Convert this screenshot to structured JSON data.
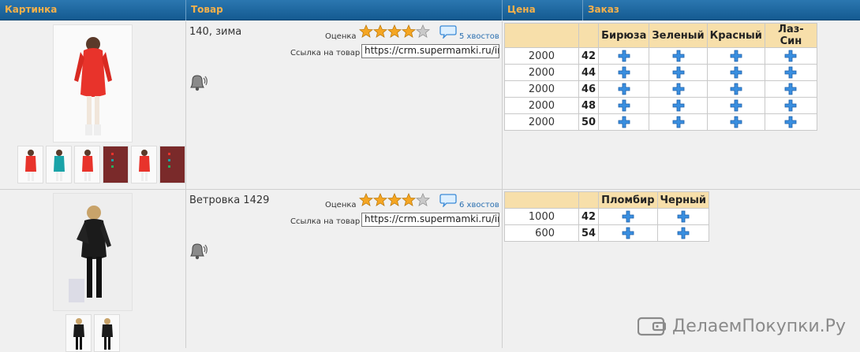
{
  "header": {
    "cols": [
      "Картинка",
      "Товар",
      "Цена",
      "Заказ"
    ]
  },
  "products": [
    {
      "name": "140, зима",
      "rating_label": "Оценка",
      "stars_filled": 4,
      "stars_total": 5,
      "reviews": "5 хвостов",
      "link_label": "Ссылка на товар",
      "link_value": "https://crm.supermamki.ru/index.php",
      "colors": [
        "Бирюза",
        "Зеленый",
        "Красный",
        "Лаз-Син"
      ],
      "rows": [
        {
          "price": "2000",
          "size": "42"
        },
        {
          "price": "2000",
          "size": "44"
        },
        {
          "price": "2000",
          "size": "46"
        },
        {
          "price": "2000",
          "size": "48"
        },
        {
          "price": "2000",
          "size": "50"
        }
      ],
      "image_color": "#e8332b",
      "thumb_colors": [
        "#e8332b",
        "#1aa3a8",
        "#e8332b",
        "#7a2a2a",
        "#e8332b",
        "#7a2a2a"
      ]
    },
    {
      "name": "Ветровка 1429",
      "rating_label": "Оценка",
      "stars_filled": 4,
      "stars_total": 5,
      "reviews": "6 хвостов",
      "link_label": "Ссылка на товар",
      "link_value": "https://crm.supermamki.ru/index.php",
      "colors": [
        "Пломбир",
        "Черный"
      ],
      "rows": [
        {
          "price": "1000",
          "size": "42"
        },
        {
          "price": "600",
          "size": "54"
        }
      ],
      "image_color": "#1b1b1b",
      "thumb_colors": [
        "#1b1b1b",
        "#1b1b1b"
      ]
    }
  ],
  "watermark": "ДелаемПокупки.Ру",
  "accent": {
    "header_bg": "#145a91",
    "header_text": "#f6b14a",
    "table_head": "#f7dfaa",
    "plus": "#3a8fe0"
  }
}
